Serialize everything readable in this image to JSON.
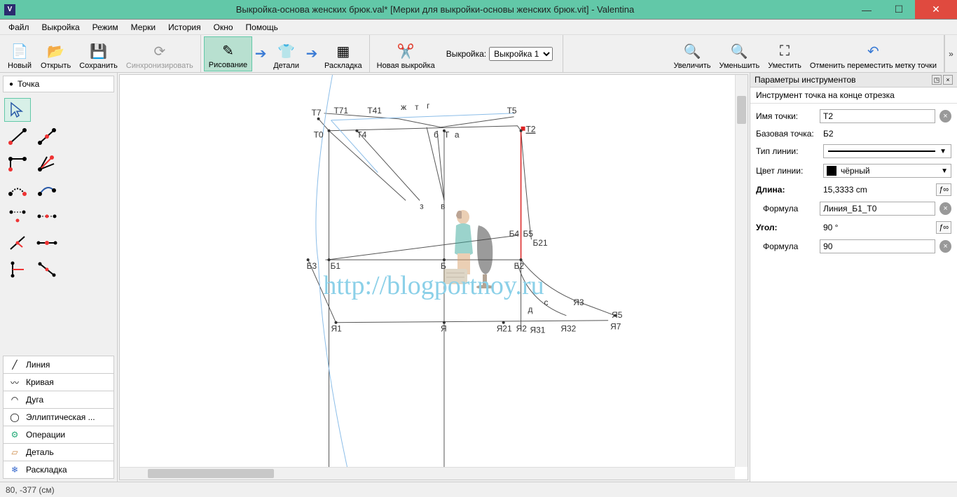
{
  "window": {
    "title": "Выкройка-основа женских брюк.val* [Мерки для выкройки-основы женских брюк.vit] - Valentina"
  },
  "menu": {
    "file": "Файл",
    "pattern": "Выкройка",
    "mode": "Режим",
    "measure": "Мерки",
    "history": "История",
    "window": "Окно",
    "help": "Помощь"
  },
  "toolbar": {
    "new": "Новый",
    "open": "Открыть",
    "save": "Сохранить",
    "sync": "Синхронизировать",
    "draw": "Рисование",
    "details": "Детали",
    "layout": "Раскладка",
    "newpat": "Новая выкройка",
    "patlabel": "Выкройка:",
    "patvalue": "Выкройка 1",
    "zoomin": "Увеличить",
    "zoomout": "Уменьшить",
    "fit": "Уместить",
    "undo_move": "Отменить переместить метку точки"
  },
  "left": {
    "section": "Точка",
    "cats": {
      "line": "Линия",
      "curve": "Кривая",
      "arc": "Дуга",
      "ellipse": "Эллиптическая ...",
      "ops": "Операции",
      "detail": "Деталь",
      "layout": "Раскладка"
    }
  },
  "props": {
    "title": "Параметры инструментов",
    "subtitle": "Инструмент точка на конце отрезка",
    "name_lbl": "Имя точки:",
    "name_val": "Т2",
    "base_lbl": "Базовая точка:",
    "base_val": "Б2",
    "ltype_lbl": "Тип линии:",
    "lcolor_lbl": "Цвет линии:",
    "lcolor_val": "чёрный",
    "len_lbl": "Длина:",
    "len_val": "15,3333 cm",
    "formula_lbl": "Формула",
    "formula_len": "Линия_Б1_Т0",
    "angle_lbl": "Угол:",
    "angle_val": "90 °",
    "formula_ang": "90"
  },
  "statusbar": {
    "coords": "80, -377 (см)"
  },
  "canvas": {
    "watermark": "http://blogportnoy.ru",
    "points": [
      "Т7",
      "Т71",
      "Т41",
      "ж",
      "т",
      "г",
      "Т5",
      "Т0",
      "Т4",
      "б",
      "Т",
      "а",
      "Т2",
      "з",
      "в",
      "Б4",
      "Б5",
      "Б21",
      "Б3",
      "Б1",
      "Б",
      "Б2",
      "д",
      "с",
      "Я3",
      "Я1",
      "Я",
      "Я21",
      "Я2",
      "Я31",
      "Я32",
      "Я5",
      "Я7"
    ]
  }
}
